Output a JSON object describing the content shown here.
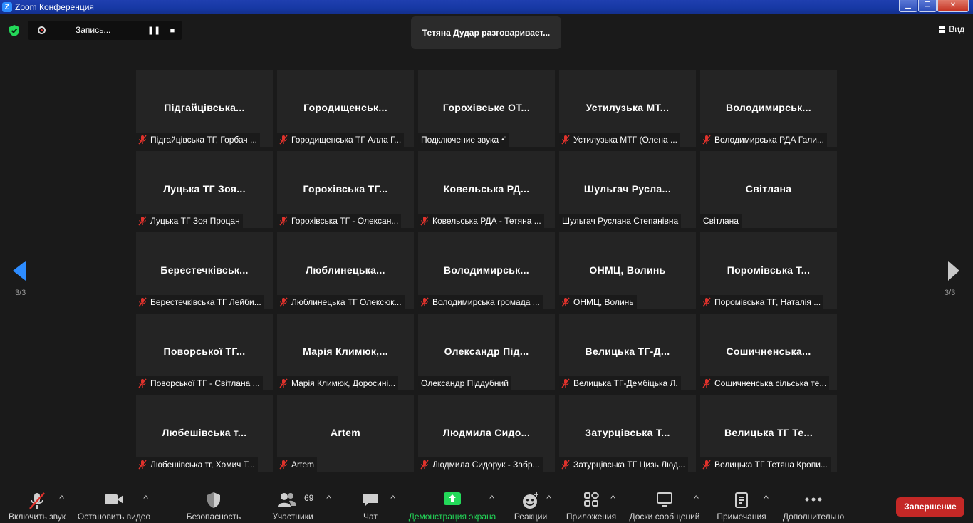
{
  "window": {
    "title": "Zoom Конференция"
  },
  "recording": {
    "label": "Запись..."
  },
  "speaking_banner": "Тетяна Дудар разговаривает...",
  "view_button": "Вид",
  "pagination": {
    "left": "3/3",
    "right": "3/3"
  },
  "tiles": [
    {
      "big": "Підгайцівська...",
      "name": "Підгайцівська ТГ, Горбач ...",
      "muted": true
    },
    {
      "big": "Городищенськ...",
      "name": "Городищенська ТГ Алла Г...",
      "muted": true
    },
    {
      "big": "Горохівське ОТ...",
      "name": "Подключение звука",
      "muted": false,
      "connecting": true
    },
    {
      "big": "Устилузька МТ...",
      "name": "Устилузька МТГ (Олена ...",
      "muted": true
    },
    {
      "big": "Володимирськ...",
      "name": "Володимирська РДА Гали...",
      "muted": true
    },
    {
      "big": "Луцька ТГ Зоя...",
      "name": "Луцька ТГ Зоя Процан",
      "muted": true
    },
    {
      "big": "Горохівська ТГ...",
      "name": "Горохівська ТГ - Олексан...",
      "muted": true
    },
    {
      "big": "Ковельська РД...",
      "name": "Ковельська РДА - Тетяна ...",
      "muted": true
    },
    {
      "big": "Шульгач Русла...",
      "name": "Шульгач Руслана Степанівна",
      "muted": false
    },
    {
      "big": "Світлана",
      "name": "Світлана",
      "muted": false
    },
    {
      "big": "Берестечківськ...",
      "name": "Берестечківська ТГ Лейби...",
      "muted": true
    },
    {
      "big": "Люблинецька...",
      "name": "Люблинецька ТГ Олексюк...",
      "muted": true
    },
    {
      "big": "Володимирськ...",
      "name": "Володимирська громада ...",
      "muted": true
    },
    {
      "big": "ОНМЦ, Волинь",
      "name": "ОНМЦ, Волинь",
      "muted": true
    },
    {
      "big": "Поромівська Т...",
      "name": "Поромівська ТГ, Наталія ...",
      "muted": true
    },
    {
      "big": "Поворської ТГ...",
      "name": "Поворської ТГ - Світлана ...",
      "muted": true
    },
    {
      "big": "Марія Климюк,...",
      "name": "Марія Климюк, Доросині...",
      "muted": true
    },
    {
      "big": "Олександр Під...",
      "name": "Олександр Піддубний",
      "muted": false
    },
    {
      "big": "Велицька ТГ-Д...",
      "name": "Велицька ТГ-Дембіцька Л.",
      "muted": true
    },
    {
      "big": "Сошичненська...",
      "name": "Сошичненська сільська те...",
      "muted": true
    },
    {
      "big": "Любешівська т...",
      "name": "Любешівська тг,  Хомич Т...",
      "muted": true
    },
    {
      "big": "Artem",
      "name": "Artem",
      "muted": true
    },
    {
      "big": "Людмила Сидо...",
      "name": "Людмила Сидорук - Забр...",
      "muted": true
    },
    {
      "big": "Затурцівська Т...",
      "name": "Затурцівська ТГ Цизь Люд...",
      "muted": true
    },
    {
      "big": "Велицька ТГ Те...",
      "name": "Велицька ТГ Тетяна Кропи...",
      "muted": true
    }
  ],
  "toolbar": {
    "unmute": "Включить звук",
    "stop_video": "Остановить видео",
    "security": "Безопасность",
    "participants": "Участники",
    "participants_count": "69",
    "chat": "Чат",
    "share": "Демонстрация экрана",
    "reactions": "Реакции",
    "apps": "Приложения",
    "whiteboards": "Доски сообщений",
    "notes": "Примечания",
    "more": "Дополнительно",
    "end": "Завершение"
  },
  "colors": {
    "share_green": "#23d959",
    "end_red": "#c42826",
    "arrow_blue": "#2d8cff"
  }
}
